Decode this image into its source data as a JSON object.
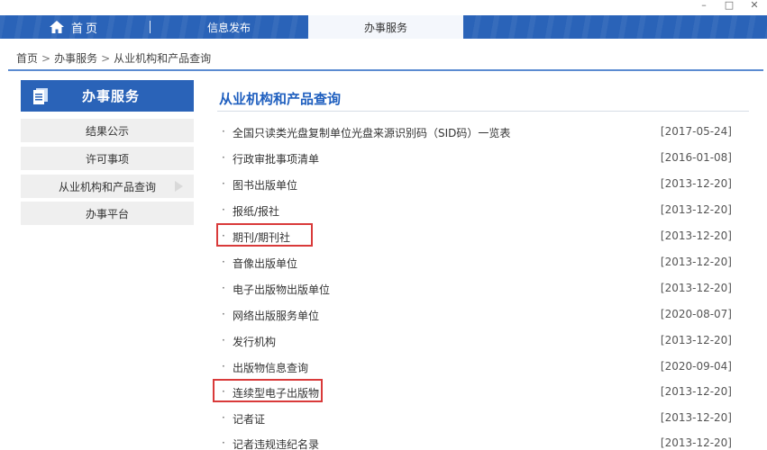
{
  "window": {
    "minimize": "–",
    "maximize": "□",
    "close": "✕"
  },
  "nav": {
    "home_label": "首页",
    "items": [
      {
        "label": "信息发布"
      },
      {
        "label": "办事服务"
      }
    ],
    "colors": {
      "bar": "#2a63b8",
      "active_bg": "#f4f7fc"
    }
  },
  "breadcrumb": {
    "items": [
      "首页",
      "办事服务",
      "从业机构和产品查询"
    ],
    "separator": ">"
  },
  "sidebar": {
    "title": "办事服务",
    "items": [
      {
        "label": "结果公示"
      },
      {
        "label": "许可事项"
      },
      {
        "label": "从业机构和产品查询"
      },
      {
        "label": "办事平台"
      }
    ]
  },
  "main": {
    "title": "从业机构和产品查询",
    "bullet": "·",
    "rows": [
      {
        "label": "全国只读类光盘复制单位光盘来源识别码（SID码）一览表",
        "date": "[2017-05-24]"
      },
      {
        "label": "行政审批事项清单",
        "date": "[2016-01-08]"
      },
      {
        "label": "图书出版单位",
        "date": "[2013-12-20]"
      },
      {
        "label": "报纸/报社",
        "date": "[2013-12-20]"
      },
      {
        "label": "期刊/期刊社",
        "date": "[2013-12-20]"
      },
      {
        "label": "音像出版单位",
        "date": "[2013-12-20]"
      },
      {
        "label": "电子出版物出版单位",
        "date": "[2013-12-20]"
      },
      {
        "label": "网络出版服务单位",
        "date": "[2020-08-07]"
      },
      {
        "label": "发行机构",
        "date": "[2013-12-20]"
      },
      {
        "label": "出版物信息查询",
        "date": "[2020-09-04]"
      },
      {
        "label": "连续型电子出版物",
        "date": "[2013-12-20]"
      },
      {
        "label": "记者证",
        "date": "[2013-12-20]"
      },
      {
        "label": "记者违规违纪名录",
        "date": "[2013-12-20]"
      }
    ],
    "highlight_color": "#d93a3a"
  }
}
